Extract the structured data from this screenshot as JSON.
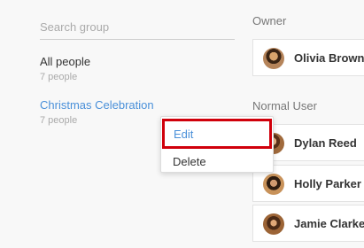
{
  "search": {
    "placeholder": "Search group",
    "value": ""
  },
  "groups": [
    {
      "name": "All people",
      "count": "7 people"
    },
    {
      "name": "Christmas Celebration",
      "count": "7 people"
    }
  ],
  "context_menu": {
    "edit_label": "Edit",
    "delete_label": "Delete"
  },
  "owner_section": {
    "title": "Owner",
    "users": [
      "Olivia Brown"
    ]
  },
  "normal_section": {
    "title": "Normal User",
    "users": [
      "Dylan Reed",
      "Holly Parker",
      "Jamie Clarke"
    ]
  },
  "colors": {
    "accent": "#4a90d9",
    "highlight_border": "#d0000b"
  }
}
